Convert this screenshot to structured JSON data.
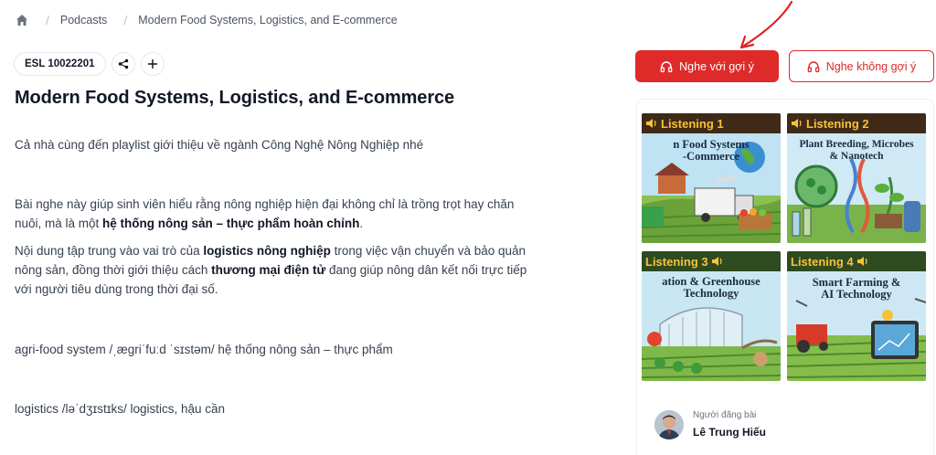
{
  "breadcrumb": {
    "home_icon": "home-icon",
    "items": [
      "Podcasts",
      "Modern Food Systems, Logistics, and E-commerce"
    ]
  },
  "tags": {
    "code": "ESL 10022201",
    "share_icon": "share-icon",
    "add_icon": "plus-icon"
  },
  "title": "Modern Food Systems, Logistics, and E-commerce",
  "content": {
    "intro": "Cả nhà cùng đến playlist giới thiệu về ngành Công Nghệ Nông Nghiệp nhé",
    "p1_a": "Bài nghe này giúp sinh viên hiểu rằng nông nghiệp hiện đại không chỉ là trồng trọt hay chăn nuôi, mà là một ",
    "p1_b": "hệ thống nông sản – thực phẩm hoàn chỉnh",
    "p1_c": ".",
    "p2_a": "Nội dung tập trung vào vai trò của ",
    "p2_b": "logistics nông nghiệp",
    "p2_c": " trong việc vận chuyển và bảo quản nông sản, đồng thời giới thiệu cách ",
    "p2_d": "thương mại điện tử",
    "p2_e": " đang giúp nông dân kết nối trực tiếp với người tiêu dùng trong thời đại số.",
    "vocab1": "agri-food system /ˌæɡriˈfuːd ˈsɪstəm/ hệ thống nông sản – thực phẩm",
    "vocab2": "logistics /ləˈdʒɪstɪks/ logistics, hậu cần"
  },
  "buttons": {
    "suggest": "Nghe với gợi ý",
    "no_suggest": "Nghe không gợi ý",
    "icon": "headphones-icon"
  },
  "thumbnails": [
    {
      "badge": "Listening 1",
      "headline_1": "n Food Systems",
      "headline_2": "-Commerce"
    },
    {
      "badge": "Listening 2",
      "headline_1": "Plant Breeding, Microbes",
      "headline_2": "& Nanotech"
    },
    {
      "badge": "Listening 3",
      "headline_1": "ation & Greenhouse",
      "headline_2": "Technology"
    },
    {
      "badge": "Listening 4",
      "headline_1": "Smart Farming &",
      "headline_2": "AI Technology"
    }
  ],
  "author": {
    "label": "Người đăng bài",
    "name": "Lê Trung Hiếu"
  },
  "colors": {
    "accent": "#df2a2a",
    "annotation": "#e02020"
  }
}
